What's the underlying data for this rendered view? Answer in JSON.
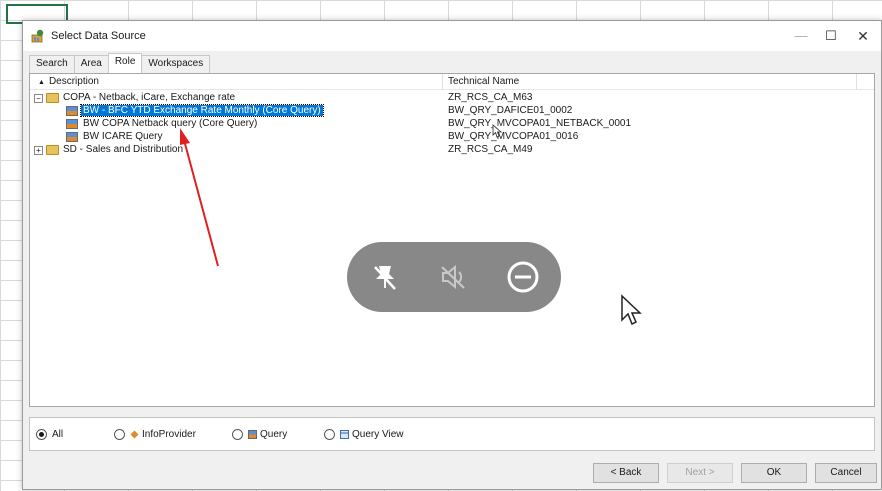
{
  "dialog": {
    "title": "Select Data Source",
    "minimize": "—",
    "maximize": "☐",
    "close": "✕"
  },
  "tabs": [
    "Search",
    "Area",
    "Role",
    "Workspaces"
  ],
  "active_tab": "Role",
  "columns": {
    "description": "Description",
    "technical_name": "Technical Name",
    "sort_glyph": "▲"
  },
  "tree": [
    {
      "expander": "⊟",
      "description": "COPA - Netback, iCare, Exchange rate",
      "technical_name": "ZR_RCS_CA_M63"
    },
    {
      "description": "BW - BFC YTD Exchange Rate Monthly (Core Query)",
      "technical_name": "BW_QRY_DAFICE01_0002",
      "selected": true
    },
    {
      "description": "BW COPA Netback query (Core Query)",
      "technical_name": "BW_QRY_MVCOPA01_NETBACK_0001"
    },
    {
      "description": "BW ICARE Query",
      "technical_name": "BW_QRY_MVCOPA01_0016"
    },
    {
      "expander": "⊞",
      "description": "SD - Sales and Distribution",
      "technical_name": "ZR_RCS_CA_M49"
    }
  ],
  "filters": [
    {
      "label": "All",
      "checked": true
    },
    {
      "label": "InfoProvider",
      "checked": false
    },
    {
      "label": "Query",
      "checked": false
    },
    {
      "label": "Query View",
      "checked": false
    }
  ],
  "buttons": {
    "back": "< Back",
    "next": "Next >",
    "ok": "OK",
    "cancel": "Cancel"
  },
  "colors": {
    "selection": "#0078d7",
    "annotation_arrow": "#e02020",
    "excel_selection": "#217346"
  },
  "overlay_icons": [
    "pin-off-icon",
    "mute-icon",
    "minus-circle-icon"
  ]
}
